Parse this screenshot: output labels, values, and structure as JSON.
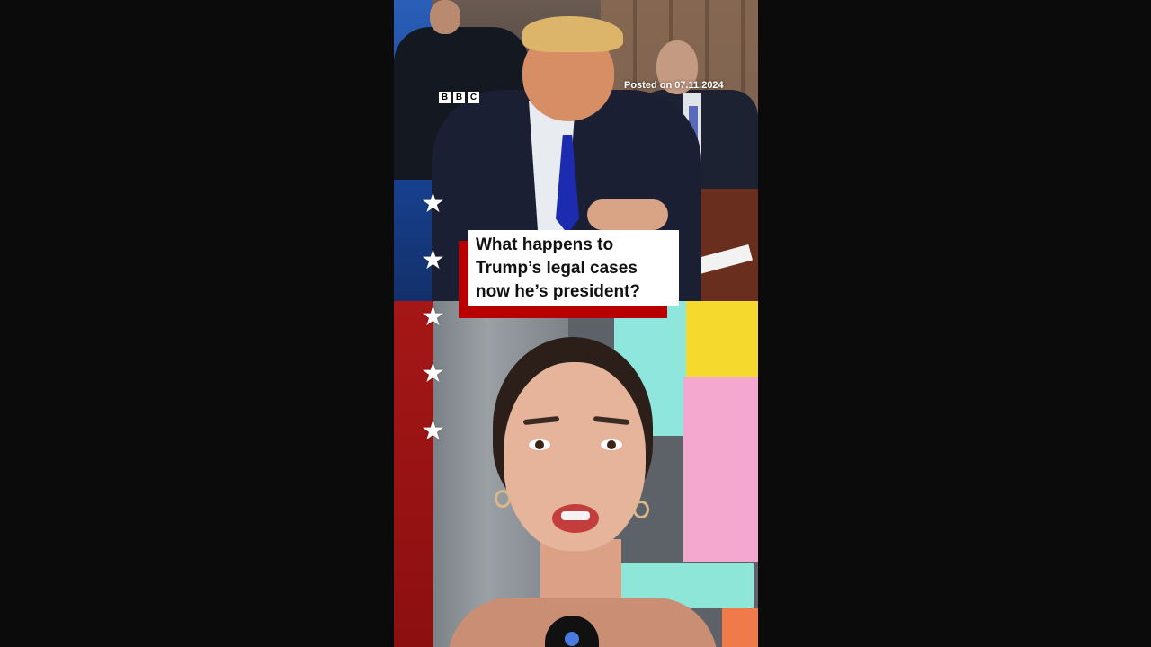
{
  "video": {
    "logo_letters": [
      "B",
      "B",
      "C"
    ],
    "posted_label": "Posted on 07.11.2024",
    "headline_lines": [
      "What happens to",
      "Trump’s legal cases",
      "now he’s president?"
    ]
  },
  "decor": {
    "star_glyph": "★",
    "star_count": 5,
    "colors": {
      "caption_accent": "#b80000",
      "blue_band": "#2a5fb8",
      "red_band": "#a51717",
      "page_background": "#0b0b0b"
    }
  }
}
